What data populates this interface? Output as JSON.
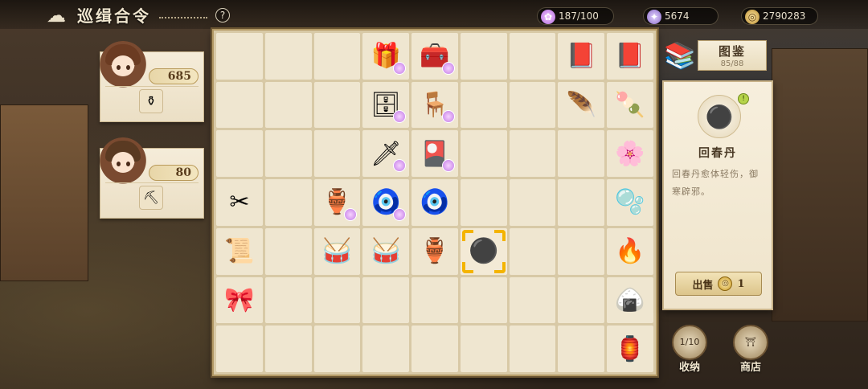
{
  "header": {
    "title": "巡缉合令",
    "help_label": "?"
  },
  "currencies": [
    {
      "name": "energy",
      "value": "187/100",
      "icon": "✿"
    },
    {
      "name": "crystal",
      "value": "5674",
      "icon": "✦"
    },
    {
      "name": "coins",
      "value": "2790283",
      "icon": "◎"
    }
  ],
  "characters": [
    {
      "count": "685",
      "wish_icon": "⚱"
    },
    {
      "count": "80",
      "wish_icon": "⛏"
    }
  ],
  "board": {
    "cells": [
      "",
      "",
      "",
      "🎁",
      "🧰",
      "",
      "",
      "📕",
      "📕",
      "",
      "",
      "",
      "🗄",
      "🪑",
      "",
      "",
      "🪶",
      "🍡",
      "",
      "",
      "",
      "🗡",
      "🎴",
      "",
      "",
      "",
      "🌸",
      "✂",
      "",
      "🏺",
      "🧿",
      "🧿",
      "",
      "",
      "",
      "🫧",
      "📜",
      "",
      "🥁",
      "🥁",
      "🏺",
      "⚫",
      "",
      "",
      "🔥",
      "🎀",
      "",
      "",
      "",
      "",
      "",
      "",
      "",
      "🍙",
      "",
      "",
      "",
      "",
      "",
      "",
      "",
      "",
      "🏮"
    ],
    "badges": [
      3,
      4,
      12,
      13,
      21,
      22,
      29,
      30
    ],
    "selected_index": 41
  },
  "catalog": {
    "label": "图鉴",
    "progress": "85/88"
  },
  "detail": {
    "item_name": "回春丹",
    "description": "回春丹愈体轻伤，御寒辟邪。",
    "item_icon": "⚫",
    "sell_label": "出售",
    "sell_price": "1"
  },
  "buttons": {
    "collect_label": "收纳",
    "collect_count": "1/10",
    "shop_label": "商店"
  }
}
